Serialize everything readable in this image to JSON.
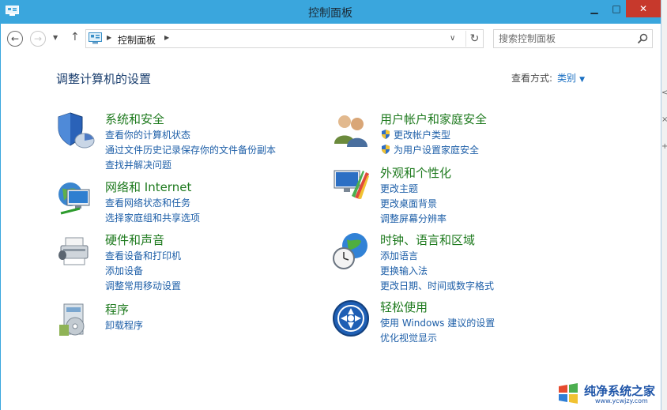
{
  "window": {
    "title": "控制面板",
    "minimize_glyph": "▁",
    "maximize_glyph": "□",
    "close_glyph": "✕"
  },
  "nav": {
    "back_glyph": "←",
    "forward_glyph": "→",
    "dropdown_glyph": "▼",
    "up_glyph": "↑",
    "breadcrumb": "控制面板",
    "address_dropdown_glyph": "∨",
    "refresh_glyph": "↻",
    "search_placeholder": "搜索控制面板"
  },
  "content": {
    "heading": "调整计算机的设置",
    "view_by_label": "查看方式:",
    "view_by_value": "类别",
    "view_by_arrow": "▼"
  },
  "categories": [
    {
      "title": "系统和安全",
      "icon": "system-security-icon",
      "links": [
        "查看你的计算机状态",
        "通过文件历史记录保存你的文件备份副本",
        "查找并解决问题"
      ]
    },
    {
      "title": "网络和 Internet",
      "icon": "network-internet-icon",
      "links": [
        "查看网络状态和任务",
        "选择家庭组和共享选项"
      ]
    },
    {
      "title": "硬件和声音",
      "icon": "hardware-sound-icon",
      "links": [
        "查看设备和打印机",
        "添加设备",
        "调整常用移动设置"
      ]
    },
    {
      "title": "程序",
      "icon": "programs-icon",
      "links": [
        "卸载程序"
      ]
    },
    {
      "title": "用户帐户和家庭安全",
      "icon": "user-accounts-icon",
      "links": [
        "更改帐户类型",
        "为用户设置家庭安全"
      ]
    },
    {
      "title": "外观和个性化",
      "icon": "appearance-icon",
      "links": [
        "更改主题",
        "更改桌面背景",
        "调整屏幕分辨率"
      ]
    },
    {
      "title": "时钟、语言和区域",
      "icon": "clock-region-icon",
      "links": [
        "添加语言",
        "更换输入法",
        "更改日期、时间或数字格式"
      ]
    },
    {
      "title": "轻松使用",
      "icon": "ease-of-access-icon",
      "links": [
        "使用 Windows 建议的设置",
        "优化视觉显示"
      ]
    }
  ],
  "watermark": {
    "name": "纯净系统之家",
    "url": "www.ycwjzy.com"
  },
  "colors": {
    "titlebar": "#3aa6dd",
    "close": "#c7392c",
    "category_title": "#1e7a1e",
    "link": "#1e5fa8",
    "heading": "#1a3e6e"
  }
}
